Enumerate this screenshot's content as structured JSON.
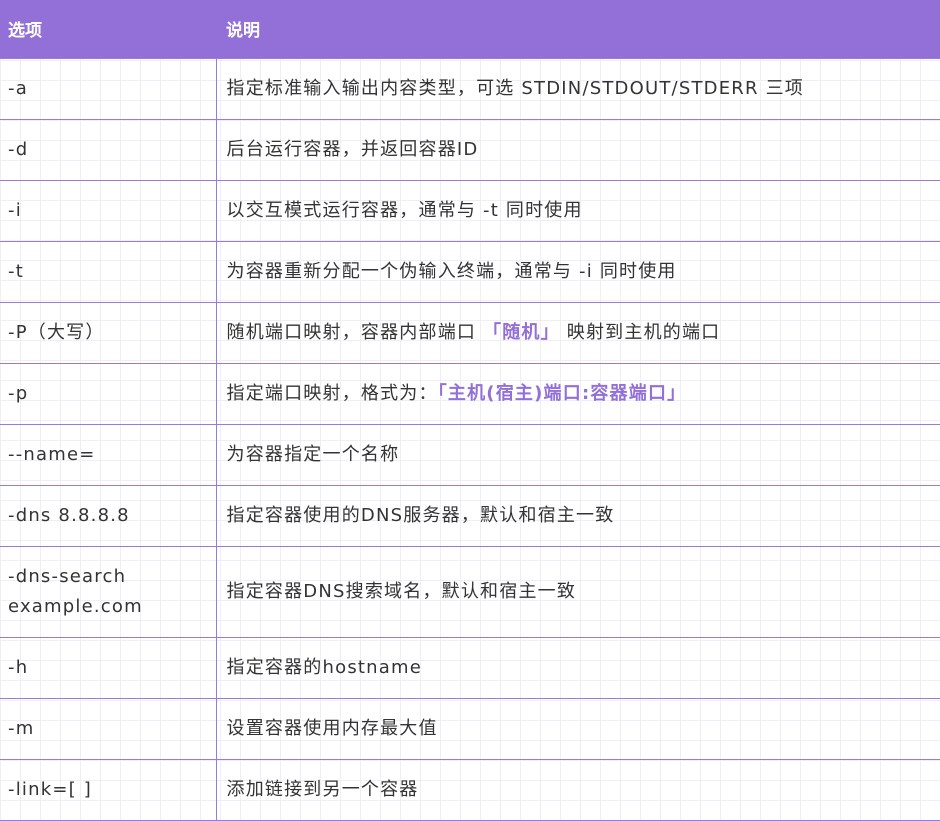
{
  "header": {
    "option": "选项",
    "description": "说明"
  },
  "rows": [
    {
      "option": "-a",
      "description": "指定标准输入输出内容类型，可选 STDIN/STDOUT/STDERR 三项"
    },
    {
      "option": "-d",
      "description": "后台运行容器，并返回容器ID"
    },
    {
      "option": "-i",
      "description": "以交互模式运行容器，通常与 -t 同时使用"
    },
    {
      "option": "-t",
      "description": "为容器重新分配一个伪输入终端，通常与 -i 同时使用"
    },
    {
      "option": "-P（大写）",
      "description_before": "随机端口映射，容器内部端口",
      "description_highlight": "「随机」",
      "description_after": "映射到主机的端口"
    },
    {
      "option": "-p",
      "description_before": "指定端口映射，格式为：",
      "description_highlight": "「主机(宿主)端口:容器端口」"
    },
    {
      "option": "--name=",
      "description": "为容器指定一个名称"
    },
    {
      "option": "-dns 8.8.8.8",
      "description": "指定容器使用的DNS服务器，默认和宿主一致"
    },
    {
      "option_line1": "-dns-search",
      "option_line2": "example.com",
      "description": "指定容器DNS搜索域名，默认和宿主一致"
    },
    {
      "option": "-h",
      "description": "指定容器的hostname"
    },
    {
      "option": "-m",
      "description": "设置容器使用内存最大值"
    },
    {
      "option": "-link=[ ]",
      "description": "添加链接到另一个容器"
    }
  ],
  "colors": {
    "header_bg": "#9370d8",
    "border": "#9a7ad8",
    "highlight": "#9370d8"
  }
}
